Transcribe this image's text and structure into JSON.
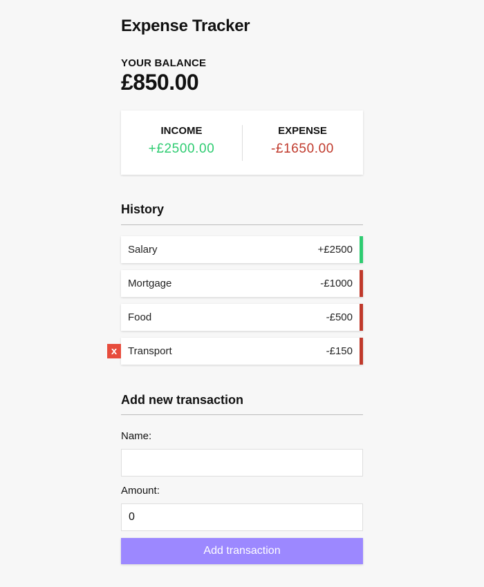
{
  "app": {
    "title": "Expense Tracker"
  },
  "balance": {
    "label": "YOUR BALANCE",
    "value": "£850.00"
  },
  "summary": {
    "income_label": "INCOME",
    "income_value": "+£2500.00",
    "expense_label": "EXPENSE",
    "expense_value": "-£1650.00"
  },
  "history": {
    "title": "History",
    "items": [
      {
        "name": "Salary",
        "amount": "+£2500",
        "type": "plus"
      },
      {
        "name": "Mortgage",
        "amount": "-£1000",
        "type": "minus"
      },
      {
        "name": "Food",
        "amount": "-£500",
        "type": "minus"
      },
      {
        "name": "Transport",
        "amount": "-£150",
        "type": "minus",
        "delete_label": "x"
      }
    ]
  },
  "form": {
    "title": "Add new transaction",
    "name_label": "Name:",
    "name_value": "",
    "amount_label": "Amount:",
    "amount_value": "0",
    "submit_label": "Add transaction"
  },
  "colors": {
    "background": "#f7f7f7",
    "income": "#2ecc71",
    "expense": "#c0392b",
    "delete": "#e74c3c",
    "button": "#9c88ff"
  }
}
